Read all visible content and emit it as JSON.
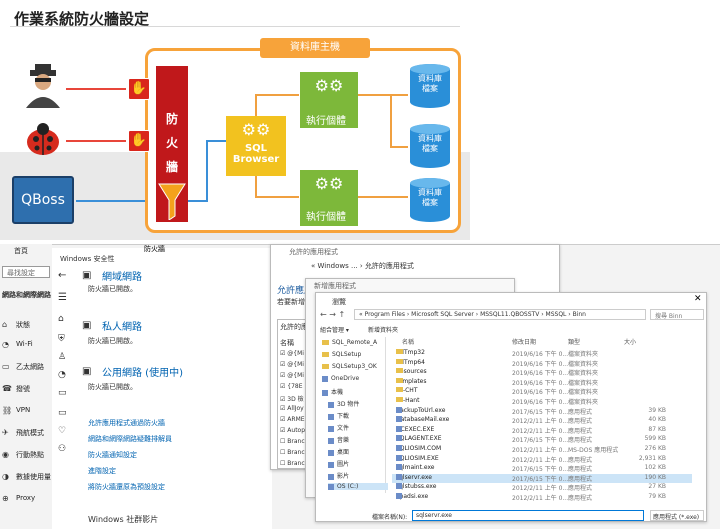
{
  "slide": {
    "title": "作業系統防火牆設定",
    "host_label": "資料庫主機",
    "firewall_chars": [
      "防",
      "火",
      "牆"
    ],
    "sql_browser": "SQL Browser",
    "exec_label": "執行個體",
    "db_label_line1": "資料庫",
    "db_label_line2": "檔案",
    "qboss_label": "QBoss"
  },
  "settings": {
    "window_title": "設定",
    "home": "首頁",
    "search_placeholder": "尋找設定",
    "section": "網路和網際網路",
    "nav": [
      "狀態",
      "Wi-Fi",
      "乙太網路",
      "撥號",
      "VPN",
      "飛航模式",
      "行動熱點",
      "數據使用量",
      "Proxy"
    ]
  },
  "security": {
    "title": "Windows 安全性",
    "tab": "防火牆",
    "domain_label": "網域網路",
    "domain_status": "防火牆已開啟。",
    "private_label": "私人網路",
    "private_status": "防火牆已開啟。",
    "public_label": "公用網路 (使用中)",
    "public_status": "防火牆已開啟。",
    "links": [
      "允許應用程式通過防火牆",
      "網路和網際網路疑難排解員",
      "防火牆通知設定",
      "進階設定",
      "將防火牆還原為預設設定"
    ],
    "footer": "Windows 社群影片"
  },
  "allowed_apps": {
    "title": "允許的應用程式",
    "breadcrumb": "« Windows ... › 允許的應用程式",
    "heading": "允許應用",
    "sub": "若要新增",
    "list_header": "允許的應用程式",
    "name_col": "名稱",
    "items": [
      "@{Mi",
      "@{Mi",
      "@{Mi",
      "{78E",
      "3D 檢",
      "AllJoy",
      "ARME",
      "Autop",
      "Branc",
      "Branc",
      "Branc"
    ]
  },
  "add_app": {
    "title": "新增應用程式"
  },
  "explorer": {
    "title": "瀏覽",
    "path": "« Program Files › Microsoft SQL Server › MSSQL11.QBOSSTV › MSSQL › Binn",
    "search_placeholder": "搜尋 Binn",
    "organize": "組合管理 ▾",
    "new_folder": "新增資料夾",
    "tree": [
      "SQL_Remote_A",
      "SQLSetup",
      "SQLSetup3_OK",
      "OneDrive",
      "本機",
      "3D 物件",
      "下載",
      "文件",
      "音樂",
      "桌面",
      "圖片",
      "影片",
      "OS (C:)"
    ],
    "col_name": "名稱",
    "col_date": "修改日期",
    "col_type": "類型",
    "col_size": "大小",
    "files": [
      {
        "name": "DllTmp32",
        "date": "2019/6/16 下午 0...",
        "type": "檔案資料夾",
        "size": "",
        "kind": "folder"
      },
      {
        "name": "DllTmp64",
        "date": "2019/6/16 下午 0...",
        "type": "檔案資料夾",
        "size": "",
        "kind": "folder"
      },
      {
        "name": "Resources",
        "date": "2019/6/16 下午 0...",
        "type": "檔案資料夾",
        "size": "",
        "kind": "folder"
      },
      {
        "name": "Templates",
        "date": "2019/6/16 下午 0...",
        "type": "檔案資料夾",
        "size": "",
        "kind": "folder"
      },
      {
        "name": "zh-CHT",
        "date": "2019/6/16 下午 0...",
        "type": "檔案資料夾",
        "size": "",
        "kind": "folder"
      },
      {
        "name": "zh-Hant",
        "date": "2019/6/16 下午 0...",
        "type": "檔案資料夾",
        "size": "",
        "kind": "folder"
      },
      {
        "name": "BackupToUrl.exe",
        "date": "2017/6/15 下午 0...",
        "type": "應用程式",
        "size": "39 KB",
        "kind": "exe"
      },
      {
        "name": "DatabaseMail.exe",
        "date": "2012/2/11 上午 0...",
        "type": "應用程式",
        "size": "40 KB",
        "kind": "exe"
      },
      {
        "name": "DCEXEC.EXE",
        "date": "2012/2/11 上午 0...",
        "type": "應用程式",
        "size": "87 KB",
        "kind": "exe"
      },
      {
        "name": "SQLAGENT.EXE",
        "date": "2017/6/15 下午 0...",
        "type": "應用程式",
        "size": "599 KB",
        "kind": "exe"
      },
      {
        "name": "SQLIOSIM.COM",
        "date": "2012/2/11 上午 0...",
        "type": "MS-DOS 應用程式",
        "size": "276 KB",
        "kind": "exe"
      },
      {
        "name": "SQLIOSIM.EXE",
        "date": "2012/2/11 上午 0...",
        "type": "應用程式",
        "size": "2,931 KB",
        "kind": "exe"
      },
      {
        "name": "sqlmaint.exe",
        "date": "2017/6/15 下午 0...",
        "type": "應用程式",
        "size": "102 KB",
        "kind": "exe"
      },
      {
        "name": "sqlservr.exe",
        "date": "2017/6/15 下午 0...",
        "type": "應用程式",
        "size": "190 KB",
        "kind": "exe",
        "selected": true
      },
      {
        "name": "sqlstubss.exe",
        "date": "2012/2/11 上午 0...",
        "type": "應用程式",
        "size": "27 KB",
        "kind": "exe"
      },
      {
        "name": "xpadsi.exe",
        "date": "2012/2/11 上午 0...",
        "type": "應用程式",
        "size": "79 KB",
        "kind": "exe"
      }
    ],
    "filename_label": "檔案名稱(N):",
    "filename_value": "sqlservr.exe",
    "filetype_value": "應用程式 (*.exe)"
  }
}
